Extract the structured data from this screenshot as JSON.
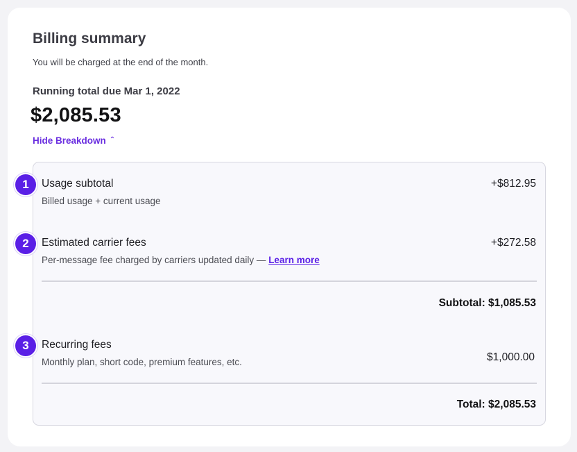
{
  "header": {
    "title": "Billing summary",
    "subtitle": "You will be charged at the end of the month."
  },
  "running_total": {
    "label": "Running total due Mar 1, 2022",
    "amount": "$2,085.53"
  },
  "toggle": {
    "label": "Hide Breakdown",
    "chevron": "⌃"
  },
  "breakdown": {
    "items": [
      {
        "step": "1",
        "label": "Usage subtotal",
        "description": "Billed usage + current usage",
        "amount": "+$812.95"
      },
      {
        "step": "2",
        "label": "Estimated carrier fees",
        "description": "Per-message fee charged by carriers updated daily —",
        "link": "Learn more",
        "amount": "+$272.58"
      },
      {
        "step": "3",
        "label": "Recurring fees",
        "description": "Monthly plan, short code, premium features, etc.",
        "amount": "$1,000.00"
      }
    ],
    "subtotal": "Subtotal: $1,085.53",
    "total": "Total: $2,085.53"
  },
  "colors": {
    "accent": "#5a1fe6",
    "link": "#6a2ee0",
    "panel_bg": "#f8f8fc",
    "page_bg": "#f3f3f6"
  }
}
